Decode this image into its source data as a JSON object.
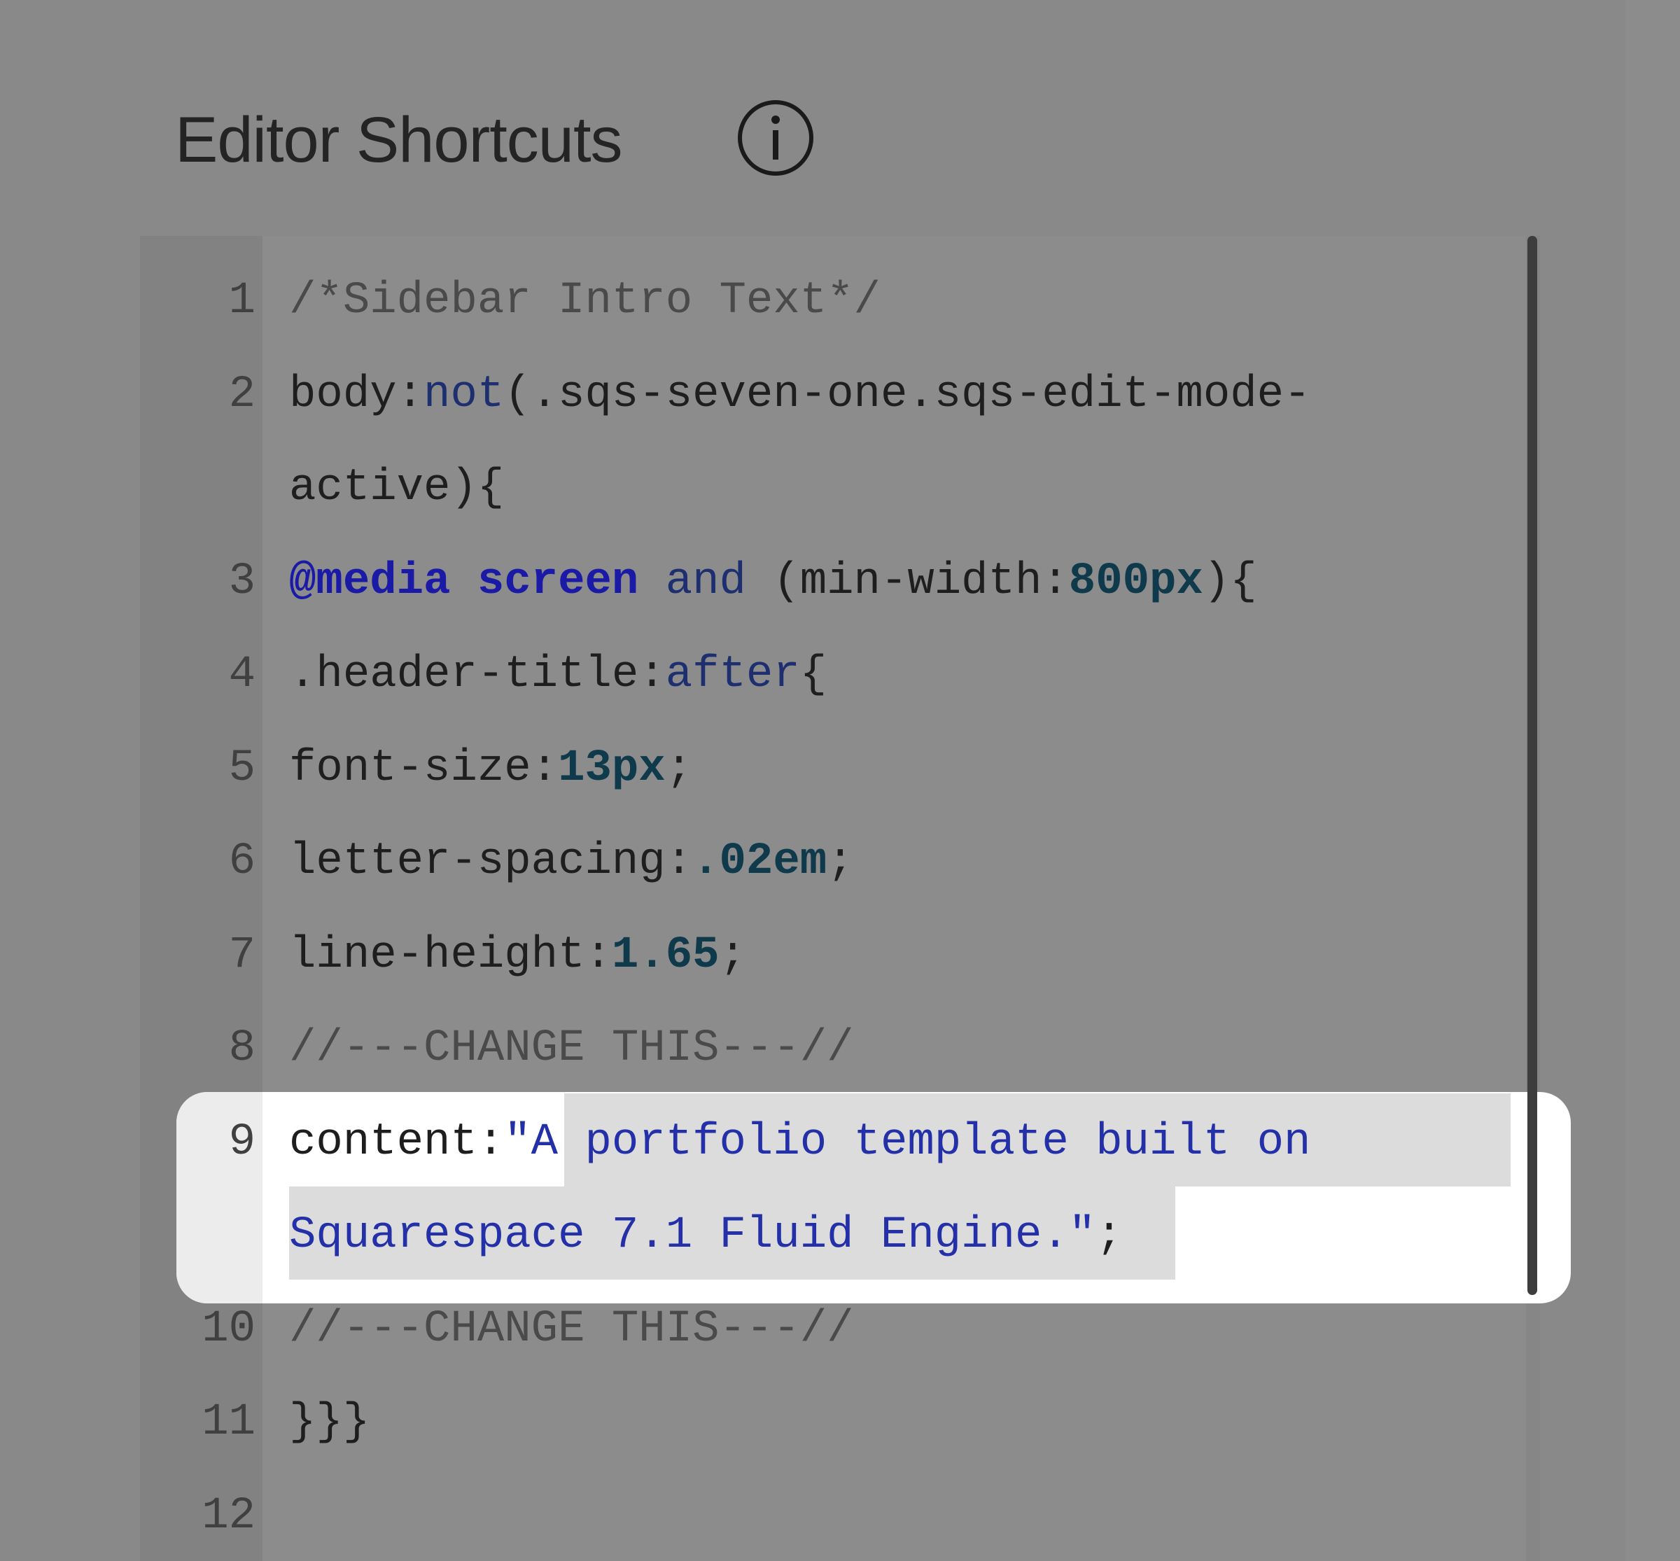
{
  "header": {
    "title": "Editor Shortcuts",
    "info_icon": "info-icon"
  },
  "editor": {
    "language": "css",
    "highlighted_line": 9,
    "lines": [
      {
        "num": "1",
        "tokens": [
          "/*Sidebar Intro Text*/"
        ]
      },
      {
        "num": "2",
        "tokens": [
          "body:",
          "not",
          "(.sqs-seven-one.sqs-edit-mode-"
        ]
      },
      {
        "num": "",
        "tokens": [
          "active){"
        ]
      },
      {
        "num": "3",
        "tokens": [
          "@media",
          " ",
          "screen",
          " ",
          "and",
          " (min-width:",
          "800px",
          "){"
        ]
      },
      {
        "num": "4",
        "tokens": [
          ".header-title:",
          "after",
          "{"
        ]
      },
      {
        "num": "5",
        "tokens": [
          "font-size:",
          "13px",
          ";"
        ]
      },
      {
        "num": "6",
        "tokens": [
          "letter-spacing:",
          ".02em",
          ";"
        ]
      },
      {
        "num": "7",
        "tokens": [
          "line-height:",
          "1.65",
          ";"
        ]
      },
      {
        "num": "8",
        "tokens": [
          "//---CHANGE THIS---//"
        ]
      },
      {
        "num": "9",
        "tokens": [
          "content:",
          "\"A portfolio template built on"
        ]
      },
      {
        "num": "",
        "tokens": [
          "Squarespace 7.1 Fluid Engine.\"",
          ";"
        ]
      },
      {
        "num": "10",
        "tokens": [
          "//---CHANGE THIS---//"
        ]
      },
      {
        "num": "11",
        "tokens": [
          "}}}"
        ]
      },
      {
        "num": "12",
        "tokens": [
          ""
        ]
      }
    ]
  },
  "colors": {
    "backdrop": "#898989",
    "highlight": "#ffffff",
    "string": "#2430a8",
    "keyword": "#1a1aa6",
    "number": "#0e3a4c",
    "comment": "#4a4a4a"
  }
}
